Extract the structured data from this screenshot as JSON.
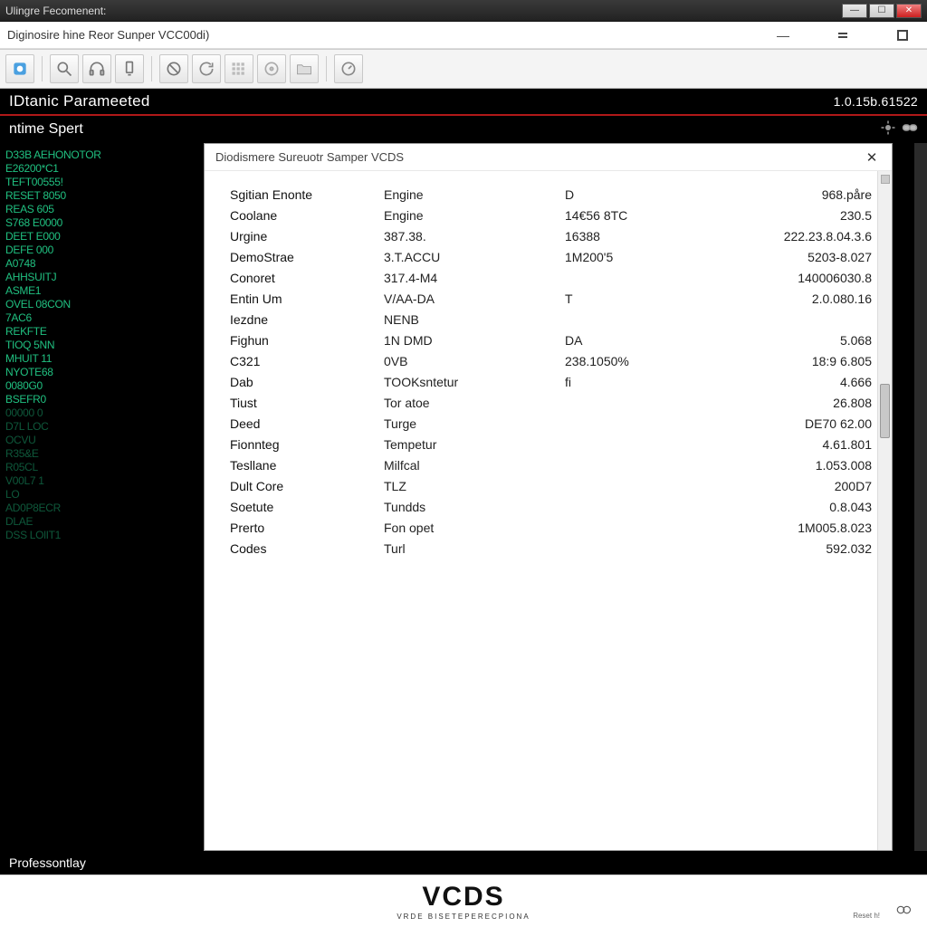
{
  "window": {
    "outer_title": "Ulingre Fecomenent:",
    "inner_title": "Diginosire hine Reor Sunper VCC00di)",
    "win_min": "—",
    "win_max": "☐",
    "win_close": "✕",
    "sub_min": "_",
    "sub_eq": "=",
    "sub_box": "☐"
  },
  "module": {
    "primary": "IDtanic Parameeted",
    "timestamp": "1.0.15b.61522",
    "secondary": "ntime Spert"
  },
  "panel": {
    "title": "Diodismere Sureuotr Samper VCDS",
    "close": "✕"
  },
  "rows": [
    {
      "c1": "Sgitian Enonte",
      "c2": "Engine",
      "c3": "D",
      "c4": "968.påre"
    },
    {
      "c1": "Coolane",
      "c2": "Engine",
      "c3": "14€56 8TC",
      "c4": "230.5"
    },
    {
      "c1": "Urgine",
      "c2": "387.38.",
      "c3": "16388",
      "c4": "222.23.8.04.3.6"
    },
    {
      "c1": "DemoStrae",
      "c2": "3.T.ACCU",
      "c3": "1M200'5",
      "c4": "5203-8.027"
    },
    {
      "c1": "Conoret",
      "c2": "317.4-M4",
      "c3": "",
      "c4": "140006030.8"
    },
    {
      "c1": "Entin Um",
      "c2": "V/AA-DA",
      "c3": "T",
      "c4": "2.0.080.16"
    },
    {
      "c1": "Iezdne",
      "c2": "NENB",
      "c3": "",
      "c4": ""
    },
    {
      "c1": "Fighun",
      "c2": "1N DMD",
      "c3": "DA",
      "c4": "5.068"
    },
    {
      "c1": "C321",
      "c2": "0VB",
      "c3": "238.1050%",
      "c4": "18:9 6.805"
    },
    {
      "c1": "Dab",
      "c2": "TOOKsntetur",
      "c3": "fi",
      "c4": "4.666"
    },
    {
      "c1": "Tiust",
      "c2": "Tor atoe",
      "c3": "",
      "c4": "26.808"
    },
    {
      "c1": "Deed",
      "c2": "Turge",
      "c3": "",
      "c4": "DE70 62.00"
    },
    {
      "c1": "Fionnteg",
      "c2": "Tempetur",
      "c3": "",
      "c4": "4.61.801"
    },
    {
      "c1": "Tesllane",
      "c2": "Milfcal",
      "c3": "",
      "c4": "1.053.008"
    },
    {
      "c1": "Dult Core",
      "c2": "TLZ",
      "c3": "",
      "c4": "200D7"
    },
    {
      "c1": "Soetute",
      "c2": "Tundds",
      "c3": "",
      "c4": "0.8.043"
    },
    {
      "c1": "Prerto",
      "c2": "Fon opet",
      "c3": "",
      "c4": "1M005.8.023"
    },
    {
      "c1": "Codes",
      "c2": "Turl",
      "c3": "",
      "c4": "592.032"
    }
  ],
  "sidebar_lines": [
    "D33B AEHONOTOR",
    "E26200*C1",
    "TEFT00555!",
    "RESET  8050",
    "REAS  605",
    "S768 E0000",
    "DEET  E000",
    "DEFE  000",
    "A0748",
    "AHHSUITJ",
    "ASME1",
    "OVEL 08CON",
    "7AC6",
    "REKFTE",
    "TIOQ  5NN",
    "MHUIT  11",
    "NYOTE68",
    "0080G0",
    "BSEFR0",
    "00000  0",
    "D7L  LOC",
    "OCVU",
    "R35&E",
    "R05CL",
    "V00L7  1",
    "LO",
    "AD0P8ECR",
    "DLAE",
    "DSS LOlIT1"
  ],
  "status": "Professontlay",
  "logo": {
    "big": "VCDS",
    "small": "VRDE BISETEPERECPIONA"
  },
  "footer_note": "Reset h!"
}
